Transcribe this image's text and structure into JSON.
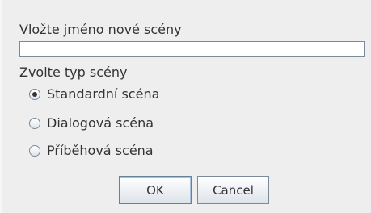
{
  "dialog": {
    "prompt_label": "Vložte jméno nové scény",
    "name_input": {
      "value": "",
      "placeholder": ""
    },
    "type_label": "Zvolte typ scény",
    "scene_types": [
      {
        "label": "Standardní scéna",
        "selected": true
      },
      {
        "label": "Dialogová scéna",
        "selected": false
      },
      {
        "label": "Příběhová scéna",
        "selected": false
      }
    ],
    "buttons": {
      "ok_label": "OK",
      "cancel_label": "Cancel"
    }
  },
  "colors": {
    "background": "#eeeeee",
    "text": "#333333",
    "border": "#7a8a99"
  }
}
